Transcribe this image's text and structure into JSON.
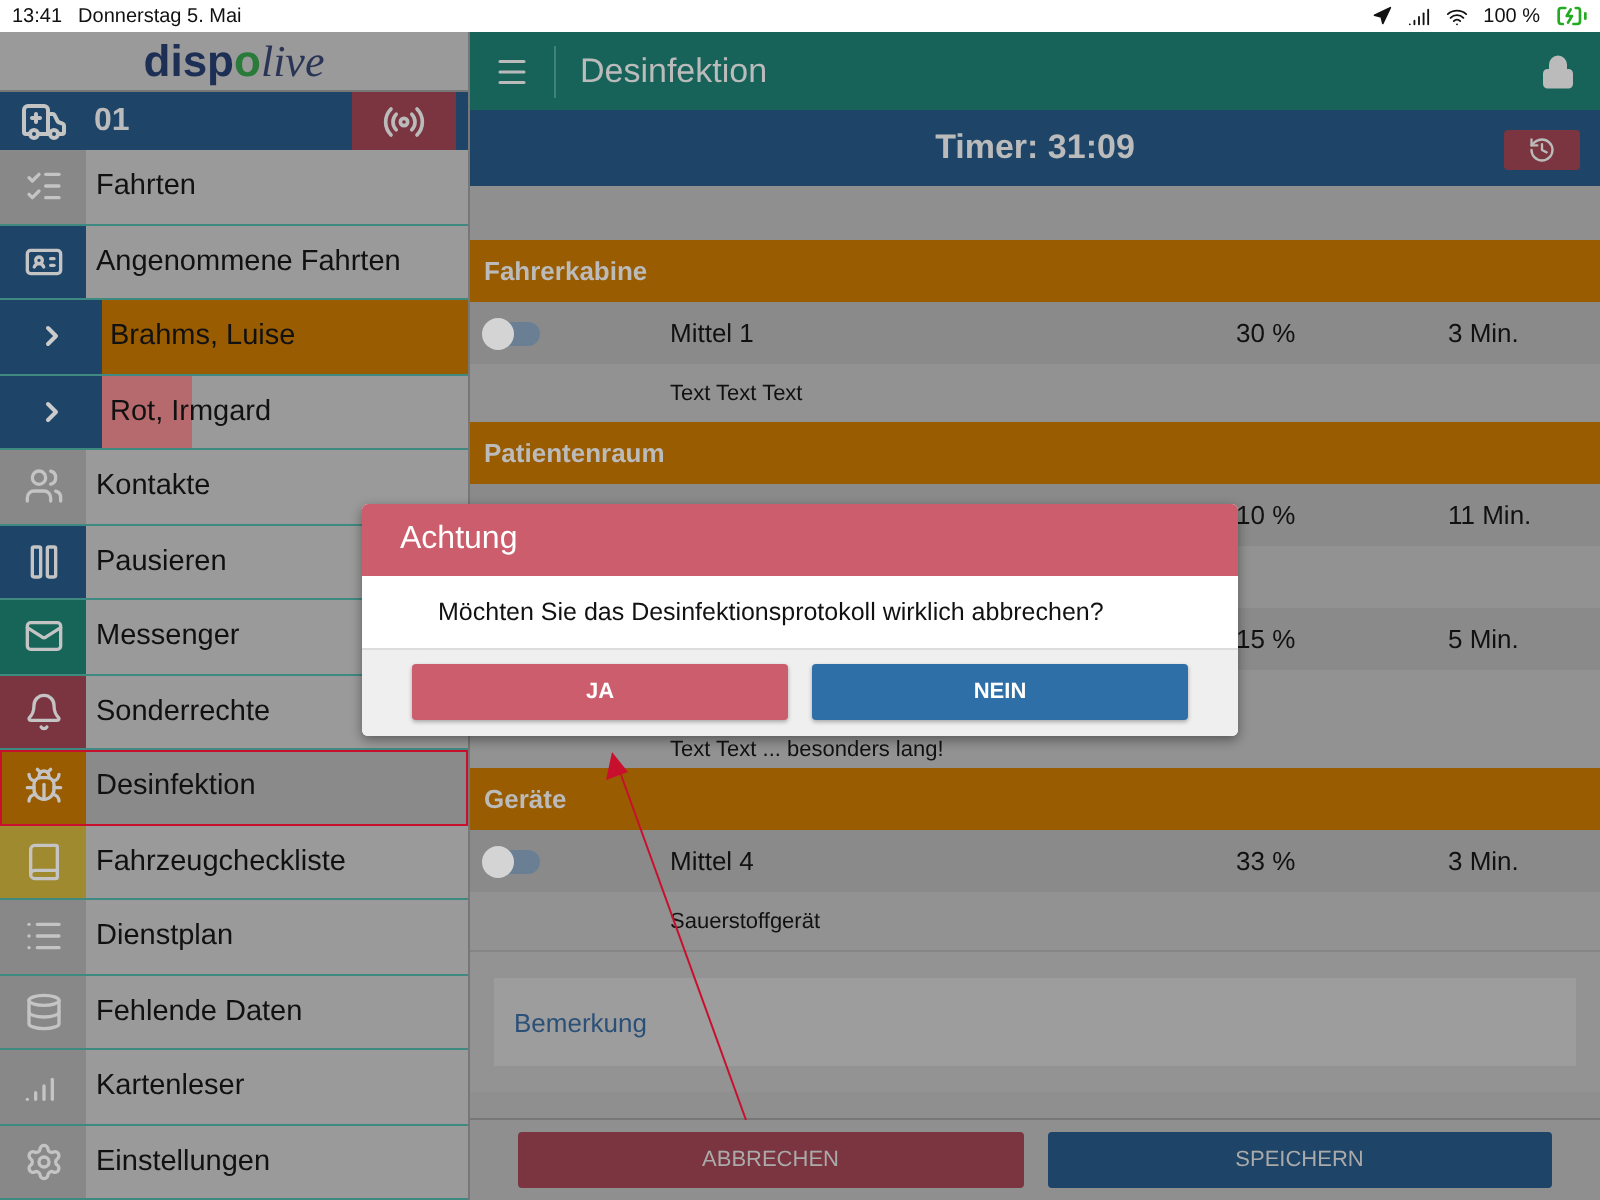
{
  "status_bar": {
    "time": "13:41",
    "date": "Donnerstag 5. Mai",
    "battery": "100 %"
  },
  "logo": {
    "first": "disp",
    "mark": "o",
    "last": "live"
  },
  "vehicle": {
    "number": "01"
  },
  "sidebar": {
    "items": [
      {
        "label": "Fahrten",
        "color": "#888888",
        "selected": false
      },
      {
        "label": "Angenommene Fahrten",
        "color": "#1e4468",
        "selected": false,
        "children": [
          {
            "label": "Brahms, Luise",
            "color": "#9a5c00",
            "highlight": true
          },
          {
            "label": "Rot, Irmgard",
            "color": "#b76a6e",
            "highlight": false
          }
        ]
      },
      {
        "label": "Kontakte",
        "color": "#888888",
        "selected": false
      },
      {
        "label": "Pausieren",
        "color": "#1e4468",
        "selected": false
      },
      {
        "label": "Messenger",
        "color": "#176458",
        "selected": false
      },
      {
        "label": "Sonderrechte",
        "color": "#7a3540",
        "selected": false
      },
      {
        "label": "Desinfektion",
        "color": "#9a5c00",
        "selected": true
      },
      {
        "label": "Fahrzeugcheckliste",
        "color": "#a08a30",
        "selected": false
      },
      {
        "label": "Dienstplan",
        "color": "#888888",
        "selected": false
      },
      {
        "label": "Fehlende Daten",
        "color": "#888888",
        "selected": false
      },
      {
        "label": "Kartenleser",
        "color": "#888888",
        "selected": false
      },
      {
        "label": "Einstellungen",
        "color": "#888888",
        "selected": false
      }
    ]
  },
  "header": {
    "title": "Desinfektion"
  },
  "timer": {
    "label": "Timer: 31:09"
  },
  "sections": [
    {
      "title": "Fahrerkabine",
      "rows": [
        {
          "name": "Mittel 1",
          "on": false,
          "percent": "30 %",
          "time": "3 Min.",
          "note": "Text Text Text"
        }
      ]
    },
    {
      "title": "Patientenraum",
      "rows": [
        {
          "percent": "10 %",
          "time": "11 Min."
        },
        {
          "percent": "15 %",
          "time": "5 Min.",
          "note": "Text Text ... besonders lang!",
          "expanded": true
        }
      ]
    },
    {
      "title": "Geräte",
      "rows": [
        {
          "name": "Mittel 4",
          "on": false,
          "percent": "33 %",
          "time": "3 Min.",
          "note": "Sauerstoffgerät"
        }
      ]
    }
  ],
  "remark": {
    "placeholder": "Bemerkung"
  },
  "footer": {
    "buttons": [
      {
        "label": "ABBRECHEN",
        "kind": "cancel"
      },
      {
        "label": "SPEICHERN",
        "kind": "save"
      }
    ]
  },
  "dialog": {
    "title": "Achtung",
    "message": "Möchten Sie das Desinfektionsprotokoll wirklich abbrechen?",
    "buttons": [
      {
        "label": "JA",
        "kind": "yes"
      },
      {
        "label": "NEIN",
        "kind": "no"
      }
    ]
  }
}
